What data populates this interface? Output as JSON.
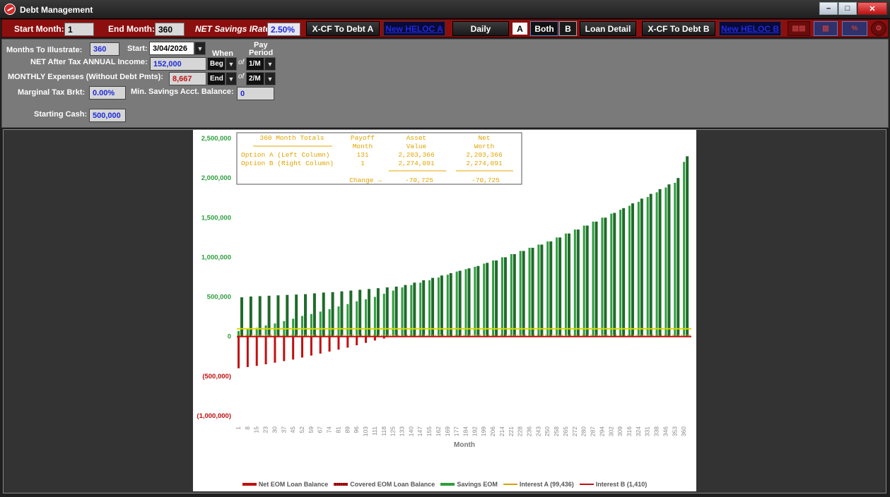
{
  "window": {
    "title": "Debt Management",
    "buttons": [
      "–",
      "□",
      "✕"
    ]
  },
  "toolbar": {
    "start_month_label": "Start Month:",
    "start_month_value": "1",
    "end_month_label": "End Month:",
    "end_month_value": "360",
    "savings_rate_label": "NET Savings IRate:",
    "savings_rate_value": "2.50%",
    "xcf_debt_a": "X-CF To Debt A",
    "new_heloc_a": "New HELOC A",
    "daily": "Daily",
    "option_a": "A",
    "option_both": "Both",
    "option_b": "B",
    "loan_detail": "Loan Detail",
    "xcf_debt_b": "X-CF To Debt B",
    "new_heloc_b": "New HELOC B"
  },
  "settings": {
    "months_label": "Months To Illustrate:",
    "months_value": "360",
    "start_label": "Start:",
    "start_value": "3/04/2026",
    "when_label": "When",
    "pay_period_label_1": "Pay",
    "pay_period_label_2": "Period",
    "income_label": "NET After Tax ANNUAL Income:",
    "income_value": "152,000",
    "income_when": "Beg",
    "income_period": "1/M",
    "expenses_label": "MONTHLY Expenses (Without Debt Pmts):",
    "expenses_value": "8,667",
    "expenses_when": "End",
    "expenses_period": "2/M",
    "of_label": "of",
    "tax_label": "Marginal Tax Brkt:",
    "tax_value": "0.00%",
    "min_savings_label": "Min. Savings Acct. Balance:",
    "min_savings_value": "0",
    "cash_label": "Starting Cash:",
    "cash_value": "500,000"
  },
  "summary_table": {
    "title": "360 Month Totals",
    "col_payoff_1": "Payoff",
    "col_payoff_2": "Month",
    "col_asset_1": "Asset",
    "col_asset_2": "Value",
    "col_net_1": "Net",
    "col_net_2": "Worth",
    "row_a_label": "Option A (Left  Column)",
    "row_a_payoff": "131",
    "row_a_asset": "2,203,366",
    "row_a_net": "2,203,366",
    "row_b_label": "Option B (Right Column)",
    "row_b_payoff": "1",
    "row_b_asset": "2,274,091",
    "row_b_net": "2,274,091",
    "change_label": "Change →",
    "change_asset": "-70,725",
    "change_net": "-70,725"
  },
  "colors": {
    "savings": "#2e9e3e",
    "savings_dark": "#1f6b2a",
    "loan": "#c01010",
    "interest_line": "#d8d800",
    "toolbar_red": "#8c0f0f",
    "table_text": "#e0a400"
  },
  "chart_data": {
    "type": "bar",
    "xlabel": "Month",
    "ylabel": "",
    "ylim": [
      -1000000,
      2500000
    ],
    "y_ticks": [
      {
        "value": 2500000,
        "label": "2,500,000"
      },
      {
        "value": 2000000,
        "label": "2,000,000"
      },
      {
        "value": 1500000,
        "label": "1,500,000"
      },
      {
        "value": 1000000,
        "label": "1,000,000"
      },
      {
        "value": 500000,
        "label": "500,000"
      },
      {
        "value": 0,
        "label": "0"
      },
      {
        "value": -500000,
        "label": "(500,000)"
      },
      {
        "value": -1000000,
        "label": "(1,000,000)"
      }
    ],
    "categories": [
      "1",
      "8",
      "15",
      "23",
      "30",
      "37",
      "45",
      "52",
      "59",
      "67",
      "74",
      "81",
      "89",
      "96",
      "103",
      "111",
      "118",
      "125",
      "133",
      "140",
      "147",
      "155",
      "162",
      "169",
      "177",
      "184",
      "192",
      "199",
      "206",
      "214",
      "221",
      "228",
      "236",
      "243",
      "250",
      "258",
      "265",
      "272",
      "280",
      "287",
      "294",
      "302",
      "309",
      "316",
      "324",
      "331",
      "338",
      "346",
      "353",
      "360"
    ],
    "series": [
      {
        "name": "Savings EOM",
        "option_a": [
          70000,
          90000,
          110000,
          140000,
          165000,
          195000,
          225000,
          260000,
          285000,
          315000,
          345000,
          380000,
          410000,
          445000,
          470000,
          500000,
          540000,
          580000,
          620000,
          650000,
          680000,
          710000,
          745000,
          780000,
          820000,
          850000,
          880000,
          920000,
          960000,
          1000000,
          1040000,
          1080000,
          1120000,
          1160000,
          1200000,
          1250000,
          1300000,
          1350000,
          1400000,
          1450000,
          1500000,
          1550000,
          1600000,
          1650000,
          1700000,
          1760000,
          1820000,
          1880000,
          1940000,
          2203366
        ],
        "option_b": [
          495000,
          505000,
          510000,
          515000,
          520000,
          525000,
          530000,
          535000,
          545000,
          555000,
          560000,
          570000,
          580000,
          590000,
          600000,
          610000,
          620000,
          630000,
          650000,
          680000,
          710000,
          740000,
          770000,
          800000,
          830000,
          860000,
          890000,
          930000,
          960000,
          1000000,
          1040000,
          1080000,
          1120000,
          1160000,
          1200000,
          1250000,
          1300000,
          1350000,
          1400000,
          1450000,
          1500000,
          1560000,
          1620000,
          1680000,
          1740000,
          1800000,
          1860000,
          1920000,
          2000000,
          2274091
        ]
      },
      {
        "name": "Net EOM Loan Balance",
        "option_a": [
          -400000,
          -385000,
          -370000,
          -350000,
          -330000,
          -310000,
          -290000,
          -265000,
          -240000,
          -215000,
          -190000,
          -165000,
          -140000,
          -110000,
          -80000,
          -50000,
          -25000,
          0,
          0,
          0,
          0,
          0,
          0,
          0,
          0,
          0,
          0,
          0,
          0,
          0,
          0,
          0,
          0,
          0,
          0,
          0,
          0,
          0,
          0,
          0,
          0,
          0,
          0,
          0,
          0,
          0,
          0,
          0,
          0,
          0
        ]
      },
      {
        "name": "Covered EOM Loan Balance",
        "option_a": []
      },
      {
        "name": "Interest A (99,436)",
        "values": []
      },
      {
        "name": "Interest B (1,410)",
        "values": []
      }
    ]
  },
  "legend": {
    "net_loan": "Net EOM Loan Balance",
    "covered_loan": "Covered EOM Loan Balance",
    "savings": "Savings EOM",
    "interest_a": "Interest A (99,436)",
    "interest_b": "Interest B (1,410)"
  }
}
